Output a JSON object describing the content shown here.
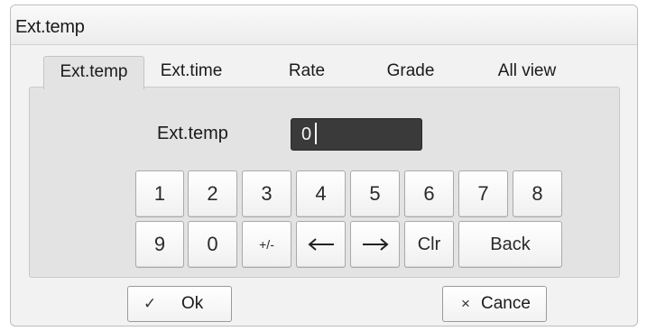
{
  "window": {
    "title": "Ext.temp"
  },
  "tabs": [
    {
      "label": "Ext.temp",
      "active": true
    },
    {
      "label": "Ext.time",
      "active": false
    },
    {
      "label": "Rate",
      "active": false
    },
    {
      "label": "Grade",
      "active": false
    },
    {
      "label": "All view",
      "active": false
    }
  ],
  "form": {
    "field_label": "Ext.temp",
    "field_value": "0"
  },
  "keypad": {
    "row1": [
      "1",
      "2",
      "3",
      "4",
      "5",
      "6",
      "7",
      "8"
    ],
    "row2": [
      "9",
      "0",
      "+/-",
      "",
      "",
      "Clr",
      "Back"
    ],
    "left_arrow_icon": "arrow-left-icon",
    "right_arrow_icon": "arrow-right-icon"
  },
  "footer": {
    "ok_icon": "✓",
    "ok_label": "Ok",
    "cancel_icon": "×",
    "cancel_label": "Cance"
  }
}
